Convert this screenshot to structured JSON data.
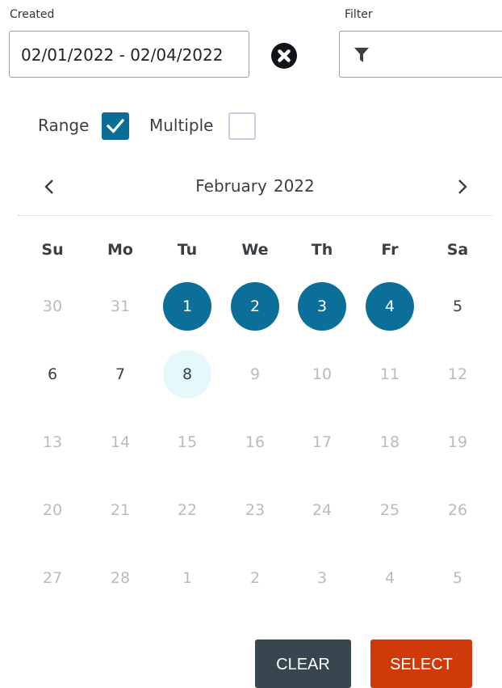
{
  "filters": {
    "created_label": "Created",
    "created_value": "02/01/2022 - 02/04/2022",
    "filter_label": "Filter",
    "filter_value": ""
  },
  "options": {
    "range_label": "Range",
    "range_checked": true,
    "multiple_label": "Multiple",
    "multiple_checked": false
  },
  "calendar": {
    "month": "February",
    "year": "2022",
    "weekdays": [
      "Su",
      "Mo",
      "Tu",
      "We",
      "Th",
      "Fr",
      "Sa"
    ],
    "weeks": [
      [
        {
          "d": "30",
          "s": "muted"
        },
        {
          "d": "31",
          "s": "muted"
        },
        {
          "d": "1",
          "s": "selected"
        },
        {
          "d": "2",
          "s": "selected"
        },
        {
          "d": "3",
          "s": "selected"
        },
        {
          "d": "4",
          "s": "selected"
        },
        {
          "d": "5",
          "s": "normal"
        }
      ],
      [
        {
          "d": "6",
          "s": "normal"
        },
        {
          "d": "7",
          "s": "normal"
        },
        {
          "d": "8",
          "s": "today"
        },
        {
          "d": "9",
          "s": "muted"
        },
        {
          "d": "10",
          "s": "muted"
        },
        {
          "d": "11",
          "s": "muted"
        },
        {
          "d": "12",
          "s": "muted"
        }
      ],
      [
        {
          "d": "13",
          "s": "muted"
        },
        {
          "d": "14",
          "s": "muted"
        },
        {
          "d": "15",
          "s": "muted"
        },
        {
          "d": "16",
          "s": "muted"
        },
        {
          "d": "17",
          "s": "muted"
        },
        {
          "d": "18",
          "s": "muted"
        },
        {
          "d": "19",
          "s": "muted"
        }
      ],
      [
        {
          "d": "20",
          "s": "muted"
        },
        {
          "d": "21",
          "s": "muted"
        },
        {
          "d": "22",
          "s": "muted"
        },
        {
          "d": "23",
          "s": "muted"
        },
        {
          "d": "24",
          "s": "muted"
        },
        {
          "d": "25",
          "s": "muted"
        },
        {
          "d": "26",
          "s": "muted"
        }
      ],
      [
        {
          "d": "27",
          "s": "muted"
        },
        {
          "d": "28",
          "s": "muted"
        },
        {
          "d": "1",
          "s": "muted"
        },
        {
          "d": "2",
          "s": "muted"
        },
        {
          "d": "3",
          "s": "muted"
        },
        {
          "d": "4",
          "s": "muted"
        },
        {
          "d": "5",
          "s": "muted"
        }
      ]
    ]
  },
  "actions": {
    "clear_label": "CLEAR",
    "select_label": "SELECT"
  },
  "icons": {
    "clear_field": "x-circle-icon",
    "filter": "funnel-icon",
    "prev": "chevron-left-icon",
    "next": "chevron-right-icon",
    "check": "checkmark-icon"
  },
  "colors": {
    "accent": "#0b6f99",
    "today": "#e5f9fb",
    "clear_button": "#37464f",
    "select_button": "#cf3a0a"
  }
}
